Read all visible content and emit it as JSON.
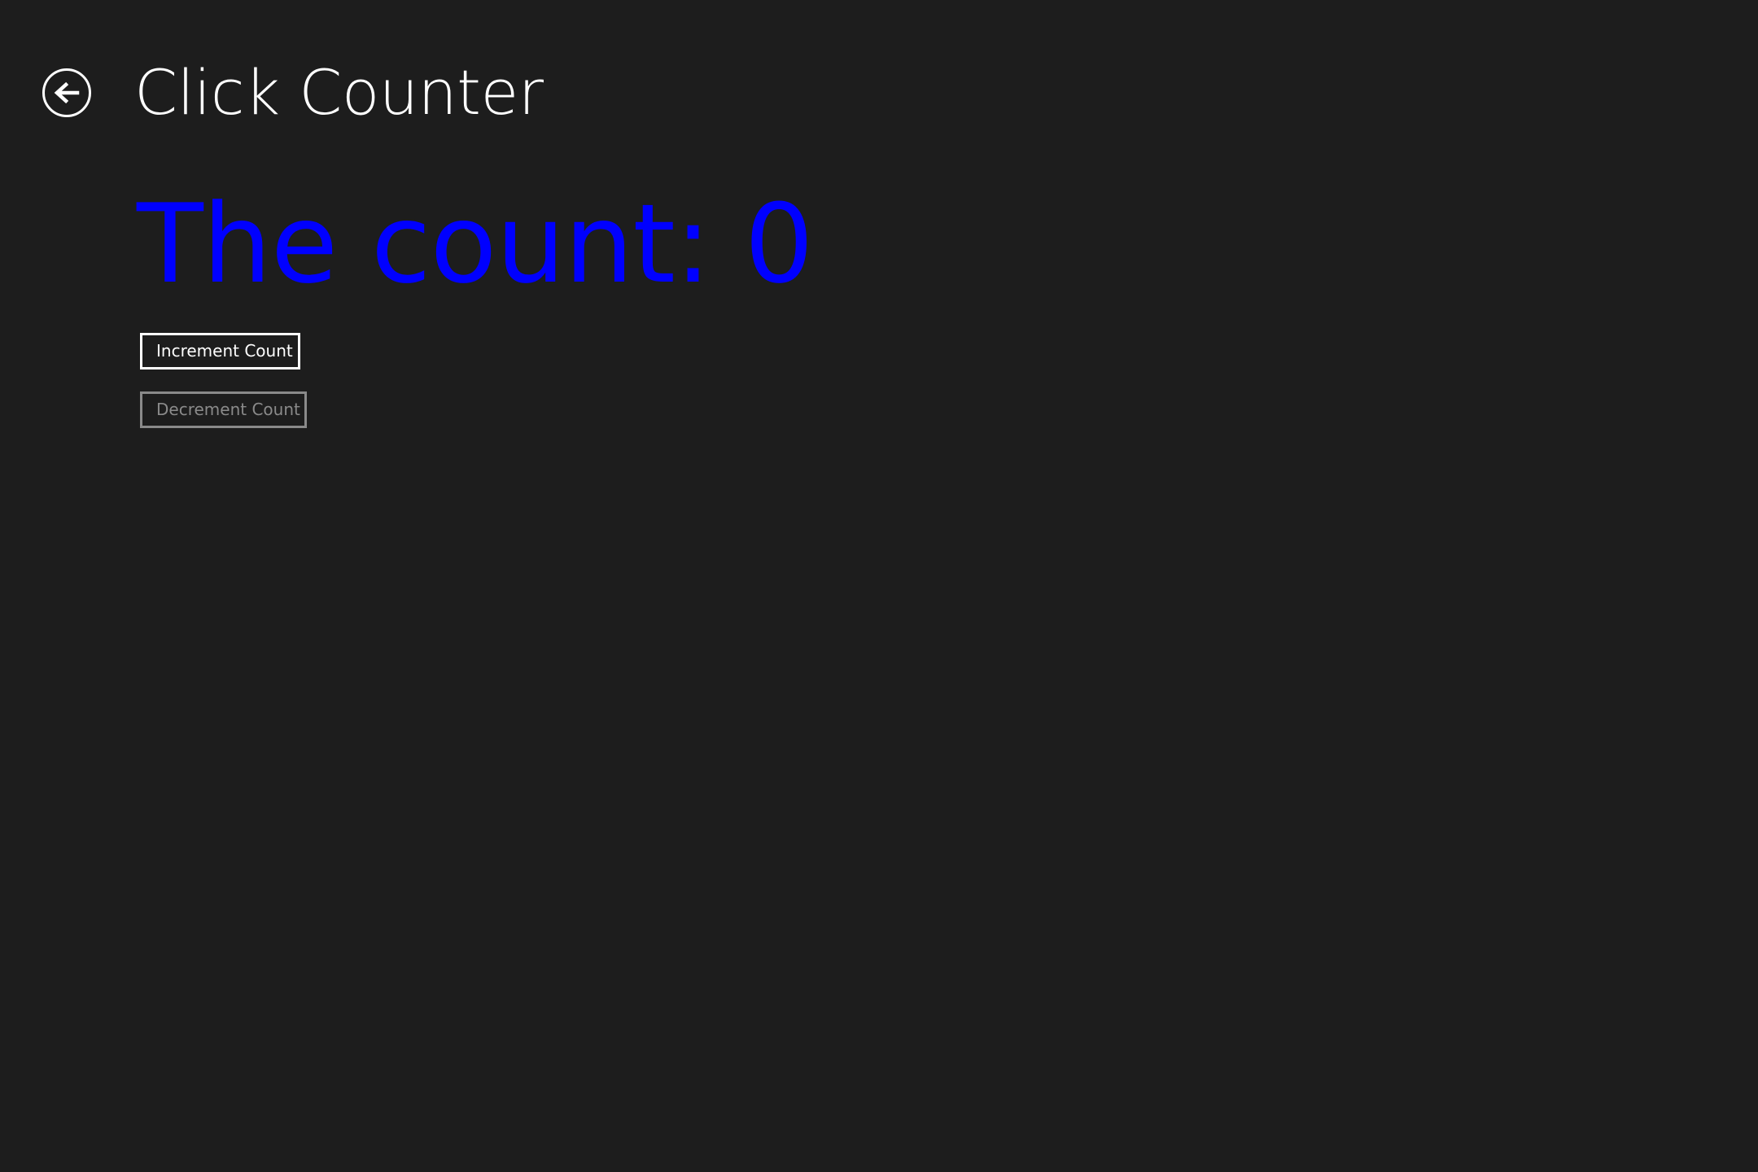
{
  "header": {
    "title": "Click Counter",
    "back_icon": "back-arrow-circle-icon"
  },
  "main": {
    "count_text": "The count: 0",
    "count_color": "#0000ff",
    "increment_label": "Increment Count",
    "decrement_label": "Decrement Count",
    "decrement_disabled": true
  },
  "colors": {
    "background": "#1d1d1d",
    "foreground": "#ffffff",
    "disabled": "#8a8a8a"
  }
}
